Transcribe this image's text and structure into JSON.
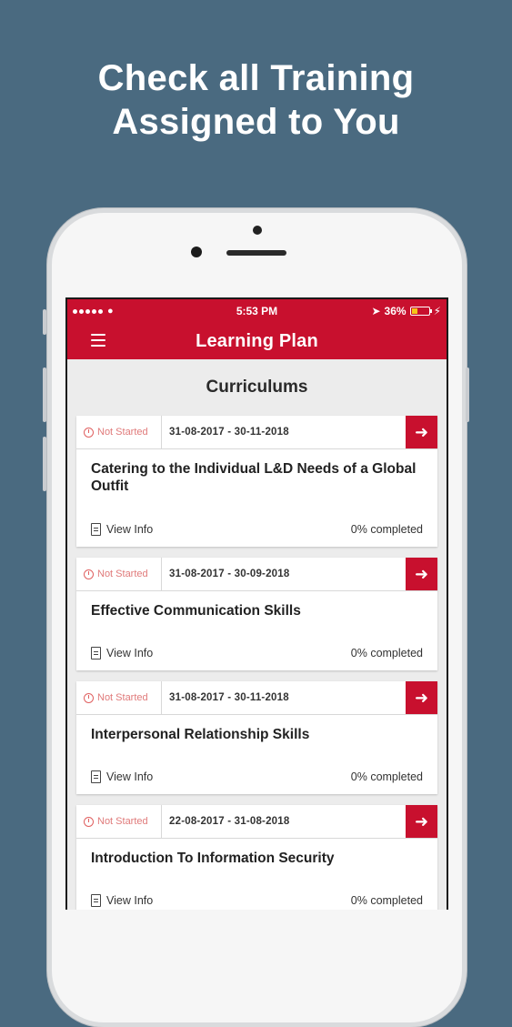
{
  "headline": [
    "Check all Training",
    "Assigned to You"
  ],
  "statusbar": {
    "time": "5:53 PM",
    "battery": "36%",
    "battery_level": 0.36
  },
  "appbar": {
    "title": "Learning Plan"
  },
  "section": {
    "title": "Curriculums"
  },
  "cards": [
    {
      "status": "Not Started",
      "dates": "31-08-2017 - 30-11-2018",
      "title": "Catering to the Individual L&D Needs of a Global Outfit",
      "info": "View Info",
      "progress": "0% completed"
    },
    {
      "status": "Not Started",
      "dates": "31-08-2017 - 30-09-2018",
      "title": "Effective Communication Skills",
      "info": "View Info",
      "progress": "0% completed"
    },
    {
      "status": "Not Started",
      "dates": "31-08-2017 - 30-11-2018",
      "title": "Interpersonal Relationship Skills",
      "info": "View Info",
      "progress": "0% completed"
    },
    {
      "status": "Not Started",
      "dates": "22-08-2017 - 31-08-2018",
      "title": "Introduction To Information Security",
      "info": "View Info",
      "progress": "0% completed"
    }
  ],
  "colors": {
    "brand": "#c8102e",
    "background": "#4a6a80",
    "status_text": "#e07a7a"
  }
}
